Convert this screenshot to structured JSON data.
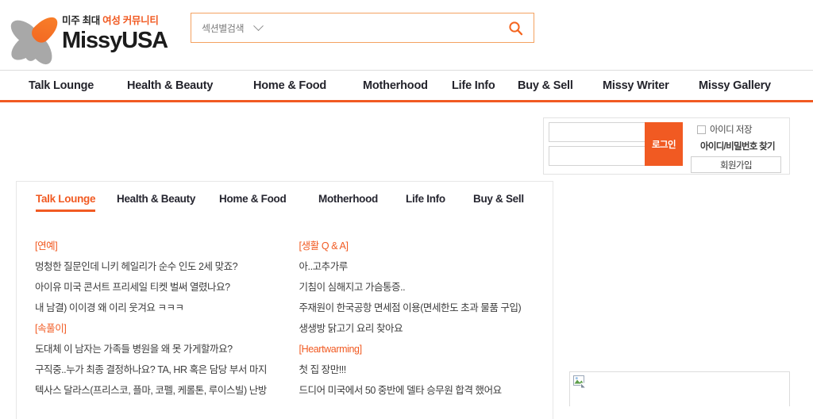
{
  "brand": {
    "tagline_pre": "미주 최대 ",
    "tagline_hl": "여성 커뮤니티",
    "wordmark": "MissyUSA",
    "accent": "#f15a22",
    "petal_gray": "#a8a8a8"
  },
  "search": {
    "section_label": "섹션별검색",
    "placeholder": "",
    "value": "",
    "icon": "search-icon",
    "chevron": "chevron-down-icon",
    "border_color": "#f4a261"
  },
  "mainnav": {
    "items": [
      {
        "label": "Talk Lounge"
      },
      {
        "label": "Health & Beauty"
      },
      {
        "label": "Home & Food"
      },
      {
        "label": "Motherhood"
      },
      {
        "label": "Life Info"
      },
      {
        "label": "Buy & Sell"
      },
      {
        "label": "Missy Writer"
      },
      {
        "label": "Missy Gallery"
      }
    ],
    "underline_color": "#f15a22"
  },
  "login": {
    "id_value": "",
    "id_placeholder": "",
    "pw_value": "",
    "pw_placeholder": "",
    "login_button": "로그인",
    "save_id_label": "아이디 저장",
    "save_id_checked": false,
    "find_link": "아이디/비밀번호 찾기",
    "signup_button": "회원가입",
    "button_color": "#f15a22"
  },
  "subtabs": {
    "items": [
      {
        "label": "Talk Lounge",
        "active": true
      },
      {
        "label": "Health & Beauty",
        "active": false
      },
      {
        "label": "Home & Food",
        "active": false
      },
      {
        "label": "Motherhood",
        "active": false
      },
      {
        "label": "Life Info",
        "active": false
      },
      {
        "label": "Buy & Sell",
        "active": false
      }
    ],
    "active_color": "#f15a22"
  },
  "list": {
    "left": [
      {
        "type": "category",
        "text": "[연예]"
      },
      {
        "type": "post",
        "text": "멍청한 질문인데 니키 헤일리가 순수 인도 2세 맞죠?"
      },
      {
        "type": "post",
        "text": "아이유 미국 콘서트 프리세일 티켓 벌써 열렸나요?"
      },
      {
        "type": "post",
        "text": "내 남결) 이이경 왜 이리 웃겨요 ㅋㅋㅋ"
      },
      {
        "type": "category",
        "text": "[속풀이]"
      },
      {
        "type": "post",
        "text": "도대체 이 남자는 가족들 병원을 왜 못 가게할까요?"
      },
      {
        "type": "post",
        "text": "구직중..누가 최종 결정하나요? TA, HR 혹은 담당 부서 마지"
      },
      {
        "type": "post",
        "text": "텍사스 달라스(프리스코, 플마, 코펠, 케롤톤, 루이스빌) 난방"
      }
    ],
    "right": [
      {
        "type": "category",
        "text": "[생활 Q & A]"
      },
      {
        "type": "post",
        "text": "아..고추가루"
      },
      {
        "type": "post",
        "text": "기침이 심해지고 가슴통증.."
      },
      {
        "type": "post",
        "text": "주재원이 한국공항 면세점 이용(면세한도 초과 물품 구입)"
      },
      {
        "type": "post",
        "text": "생생방 닭고기 요리 찾아요"
      },
      {
        "type": "category",
        "text": "[Heartwarming]"
      },
      {
        "type": "post",
        "text": "첫 집 장만!!!"
      },
      {
        "type": "post",
        "text": "드디어 미국에서 50 중반에 델타 승무원 합격 했어요"
      }
    ]
  },
  "side_banner": {
    "icon": "broken-image-icon",
    "alt": ""
  }
}
